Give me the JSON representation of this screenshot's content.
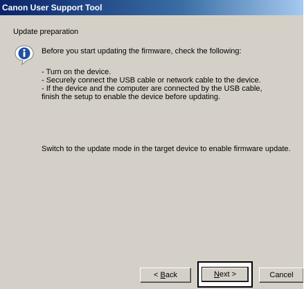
{
  "window": {
    "title": "Canon User Support Tool"
  },
  "section": {
    "title": "Update preparation"
  },
  "content": {
    "icon": "information-icon",
    "intro": "Before you start updating the firmware, check the following:",
    "bullets": [
      "- Turn on the device.",
      "- Securely connect the USB cable or network cable to the device.",
      "- If the device and the computer are connected by the USB cable,",
      "finish the setup to enable the device before updating."
    ],
    "note": "Switch to the update mode in the target device to enable firmware update."
  },
  "buttons": {
    "back_pre": "< ",
    "back_key": "B",
    "back_post": "ack",
    "next_key": "N",
    "next_post": "ext >",
    "cancel": "Cancel"
  },
  "colors": {
    "dialog_bg": "#d4d0c8",
    "titlebar_start": "#0a246a",
    "titlebar_end": "#a6caf0",
    "icon_blue": "#1e50a0"
  }
}
